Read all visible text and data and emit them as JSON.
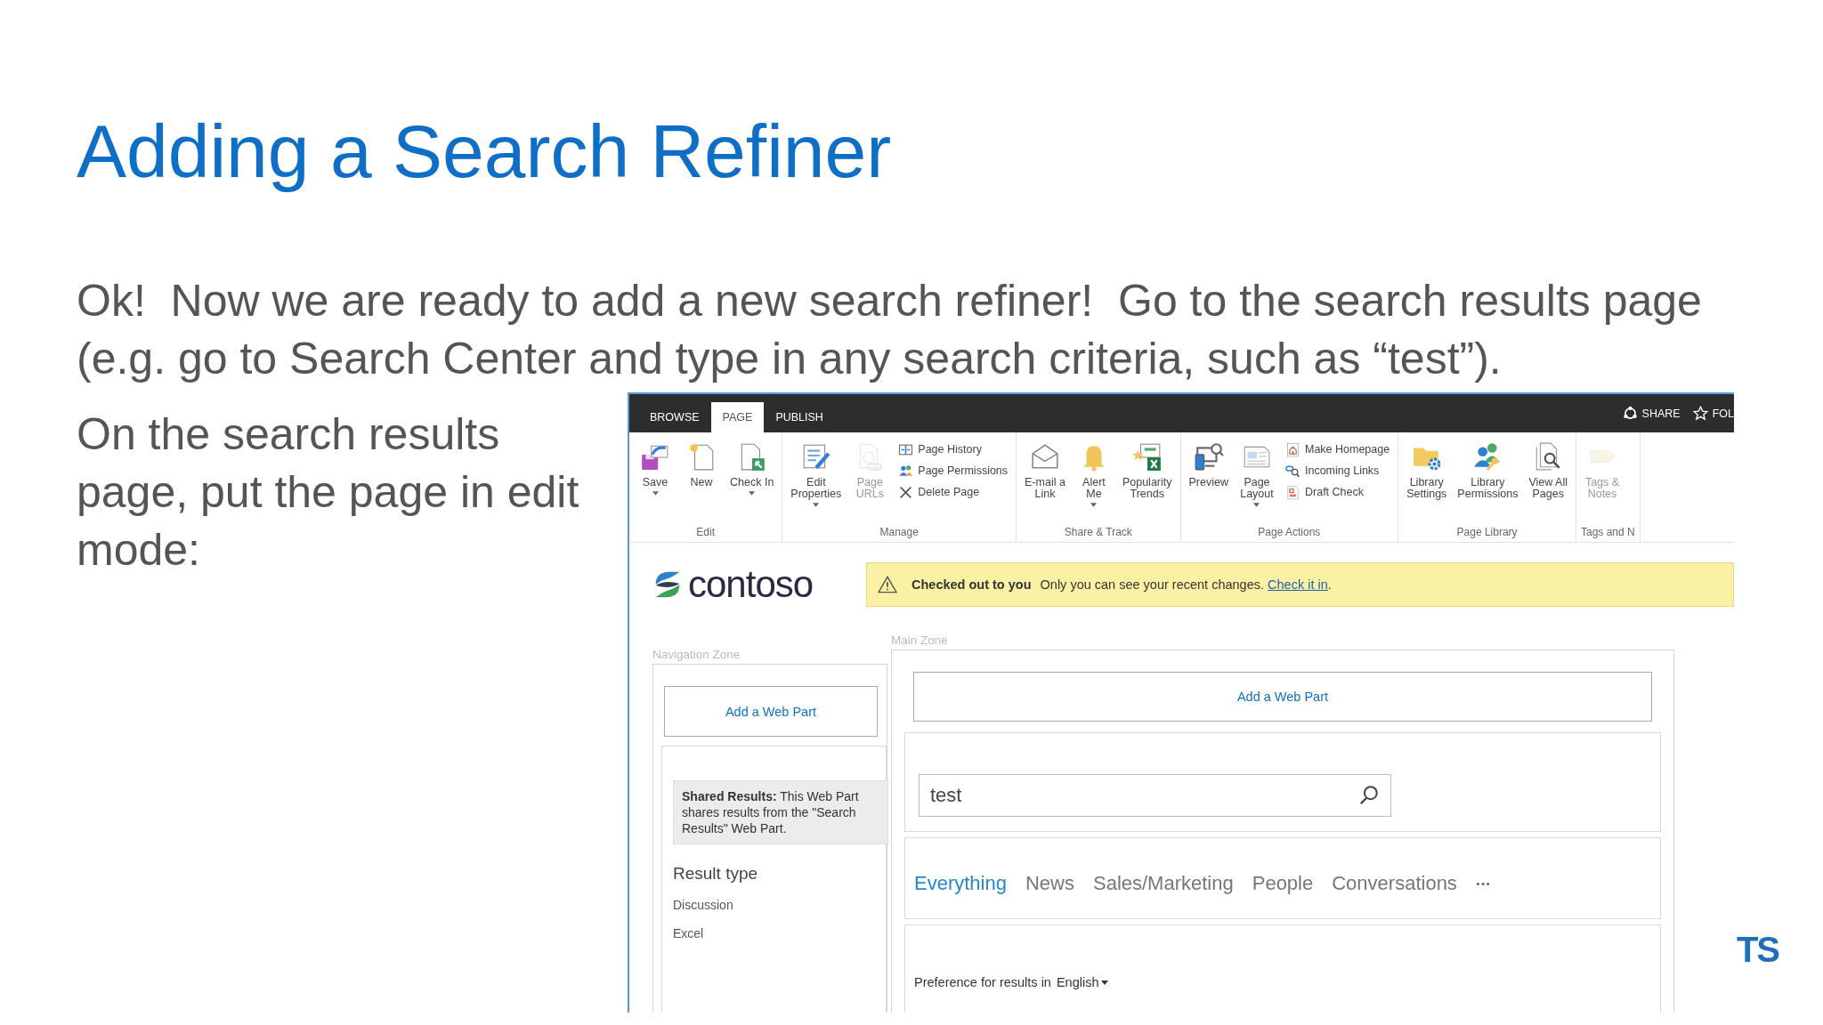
{
  "slide": {
    "title": "Adding a Search Refiner",
    "paragraphs": [
      "Ok!  Now we are ready to add a new search refiner!  Go to the search results page (e.g. go to Search Center and type in any search criteria, such as “test”).",
      "On the search results page, put the page in edit mode:"
    ],
    "logo": "TS"
  },
  "screen": {
    "tabs": [
      {
        "label": "BROWSE",
        "selected": false
      },
      {
        "label": "PAGE",
        "selected": true
      },
      {
        "label": "PUBLISH",
        "selected": false
      }
    ],
    "actions": [
      {
        "label": "SHARE"
      },
      {
        "label": "FOL"
      }
    ],
    "groups": [
      {
        "label": "Edit",
        "columns": [
          {
            "kind": "large",
            "lines": [
              "Save"
            ],
            "dropdown": true,
            "disabled": false
          },
          {
            "kind": "large",
            "lines": [
              "New"
            ],
            "dropdown": false,
            "disabled": false
          },
          {
            "kind": "large",
            "lines": [
              "Check In"
            ],
            "dropdown": true,
            "disabled": false
          }
        ]
      },
      {
        "label": "Manage",
        "columns": [
          {
            "kind": "large",
            "lines": [
              "Edit",
              "Properties"
            ],
            "dropdown": true,
            "disabled": false
          },
          {
            "kind": "large",
            "lines": [
              "Page",
              "URLs"
            ],
            "dropdown": false,
            "disabled": true
          },
          {
            "kind": "stack",
            "items": [
              {
                "label": "Page History"
              },
              {
                "label": "Page Permissions"
              },
              {
                "label": "Delete Page"
              }
            ]
          }
        ]
      },
      {
        "label": "Share & Track",
        "columns": [
          {
            "kind": "large",
            "lines": [
              "E-mail a",
              "Link"
            ],
            "dropdown": false,
            "disabled": false
          },
          {
            "kind": "large",
            "lines": [
              "Alert",
              "Me"
            ],
            "dropdown": true,
            "disabled": false
          },
          {
            "kind": "large",
            "lines": [
              "Popularity",
              "Trends"
            ],
            "dropdown": false,
            "disabled": false
          }
        ]
      },
      {
        "label": "Page Actions",
        "columns": [
          {
            "kind": "large",
            "lines": [
              "Preview"
            ],
            "dropdown": false,
            "disabled": false
          },
          {
            "kind": "large",
            "lines": [
              "Page",
              "Layout"
            ],
            "dropdown": true,
            "disabled": false
          },
          {
            "kind": "stack",
            "items": [
              {
                "label": "Make Homepage"
              },
              {
                "label": "Incoming Links"
              },
              {
                "label": "Draft Check"
              }
            ]
          }
        ]
      },
      {
        "label": "Page Library",
        "columns": [
          {
            "kind": "large",
            "lines": [
              "Library",
              "Settings"
            ],
            "dropdown": false,
            "disabled": false
          },
          {
            "kind": "large",
            "lines": [
              "Library",
              "Permissions"
            ],
            "dropdown": false,
            "disabled": false
          },
          {
            "kind": "large",
            "lines": [
              "View All",
              "Pages"
            ],
            "dropdown": false,
            "disabled": false
          }
        ]
      },
      {
        "label": "Tags and N",
        "columns": [
          {
            "kind": "large",
            "lines": [
              "Tags &",
              "Notes"
            ],
            "dropdown": false,
            "disabled": true
          }
        ]
      }
    ],
    "logo": "contoso",
    "status": {
      "title": "Checked out to you",
      "message": "Only you can see your recent changes.",
      "link": "Check it in",
      "after": "."
    },
    "nav_zone": {
      "label": "Navigation Zone",
      "add_button": "Add a Web Part",
      "note": "**Shared Results:** This Web Part shares results from the \"Search Results\" Web Part.",
      "heading": "Result type",
      "items": [
        "Discussion",
        "Excel"
      ]
    },
    "main_zone": {
      "label": "Main Zone",
      "add_button": "Add a Web Part",
      "search": {
        "value": "test"
      },
      "verticals": [
        {
          "label": "Everything",
          "selected": true
        },
        {
          "label": "News",
          "selected": false
        },
        {
          "label": "Sales/Marketing",
          "selected": false
        },
        {
          "label": "People",
          "selected": false
        },
        {
          "label": "Conversations",
          "selected": false
        }
      ],
      "preference": {
        "label": "Preference for results in",
        "value": "English"
      }
    }
  }
}
